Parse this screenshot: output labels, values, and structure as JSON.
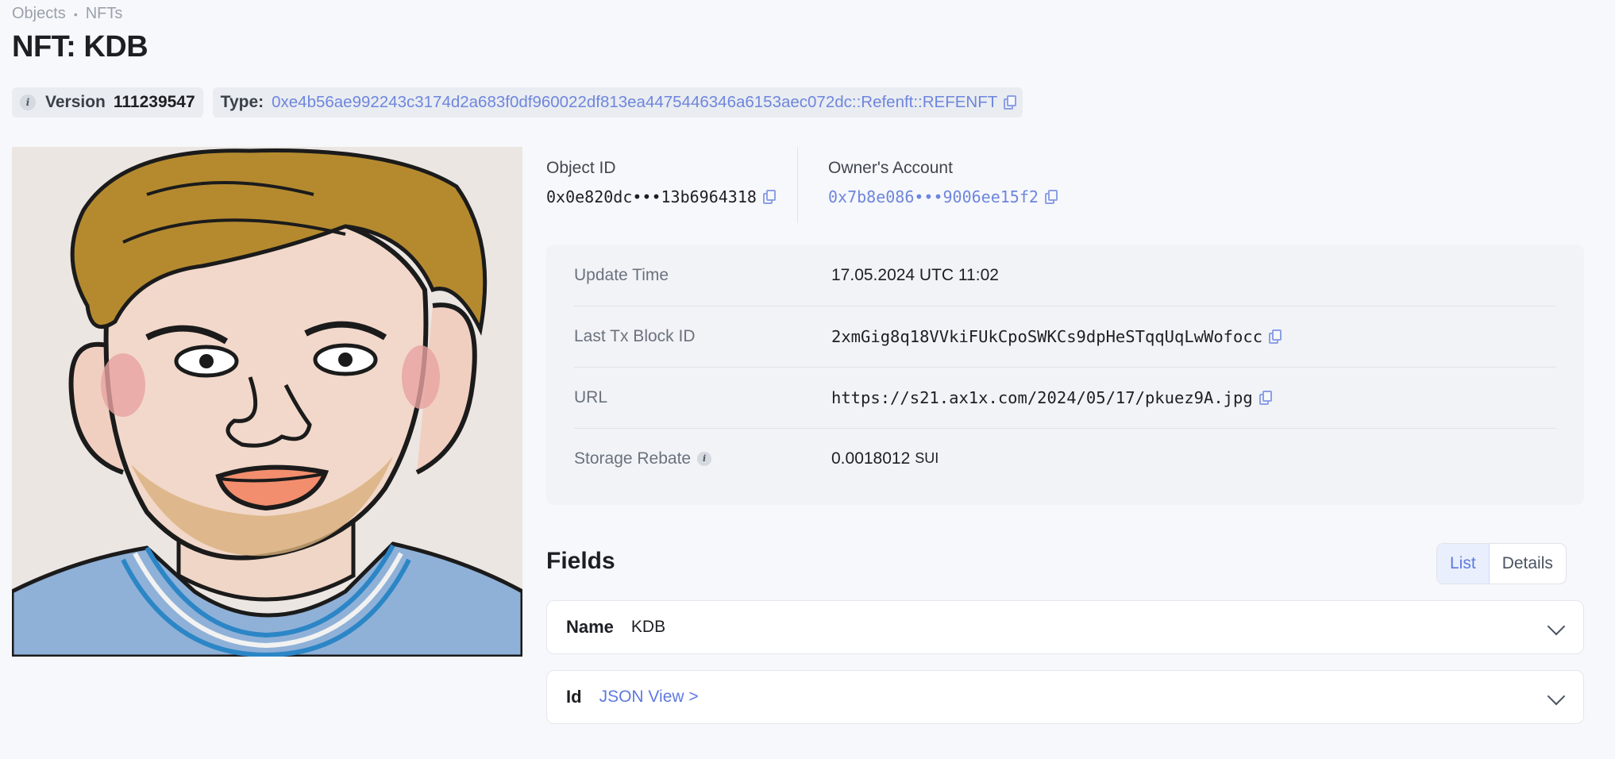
{
  "breadcrumb": {
    "items": [
      "Objects",
      "NFTs"
    ]
  },
  "page": {
    "title": "NFT: KDB"
  },
  "header": {
    "version_label": "Version",
    "version_value": "111239547",
    "type_label": "Type:",
    "type_value": "0xe4b56ae992243c3174d2a683f0df960022df813ea4475446346a6153aec072dc::Refenft::REFENFT"
  },
  "object": {
    "id_label": "Object ID",
    "id_value": "0x0e820dc•••13b6964318",
    "owner_label": "Owner's Account",
    "owner_value": "0x7b8e086•••9006ee15f2"
  },
  "details": [
    {
      "label": "Update Time",
      "value": "17.05.2024 UTC 11:02"
    },
    {
      "label": "Last Tx Block ID",
      "value": "2xmGig8q18VVkiFUkCpoSWKCs9dpHeSTqqUqLwWofocc"
    },
    {
      "label": "URL",
      "value": "https://s21.ax1x.com/2024/05/17/pkuez9A.jpg"
    },
    {
      "label": "Storage Rebate",
      "value": "0.0018012",
      "unit": "SUI"
    }
  ],
  "fields": {
    "title": "Fields",
    "view_options": [
      "List",
      "Details"
    ],
    "active_view": "List",
    "items": [
      {
        "name": "Name",
        "value": "KDB"
      },
      {
        "name": "Id",
        "value": "JSON View >"
      }
    ]
  },
  "icons": {
    "info": "info-icon",
    "copy": "copy-icon",
    "chevron": "chevron-down-icon"
  },
  "colors": {
    "background": "#f7f8fb",
    "link": "#6e86dd",
    "card": "#f1f3f7"
  }
}
